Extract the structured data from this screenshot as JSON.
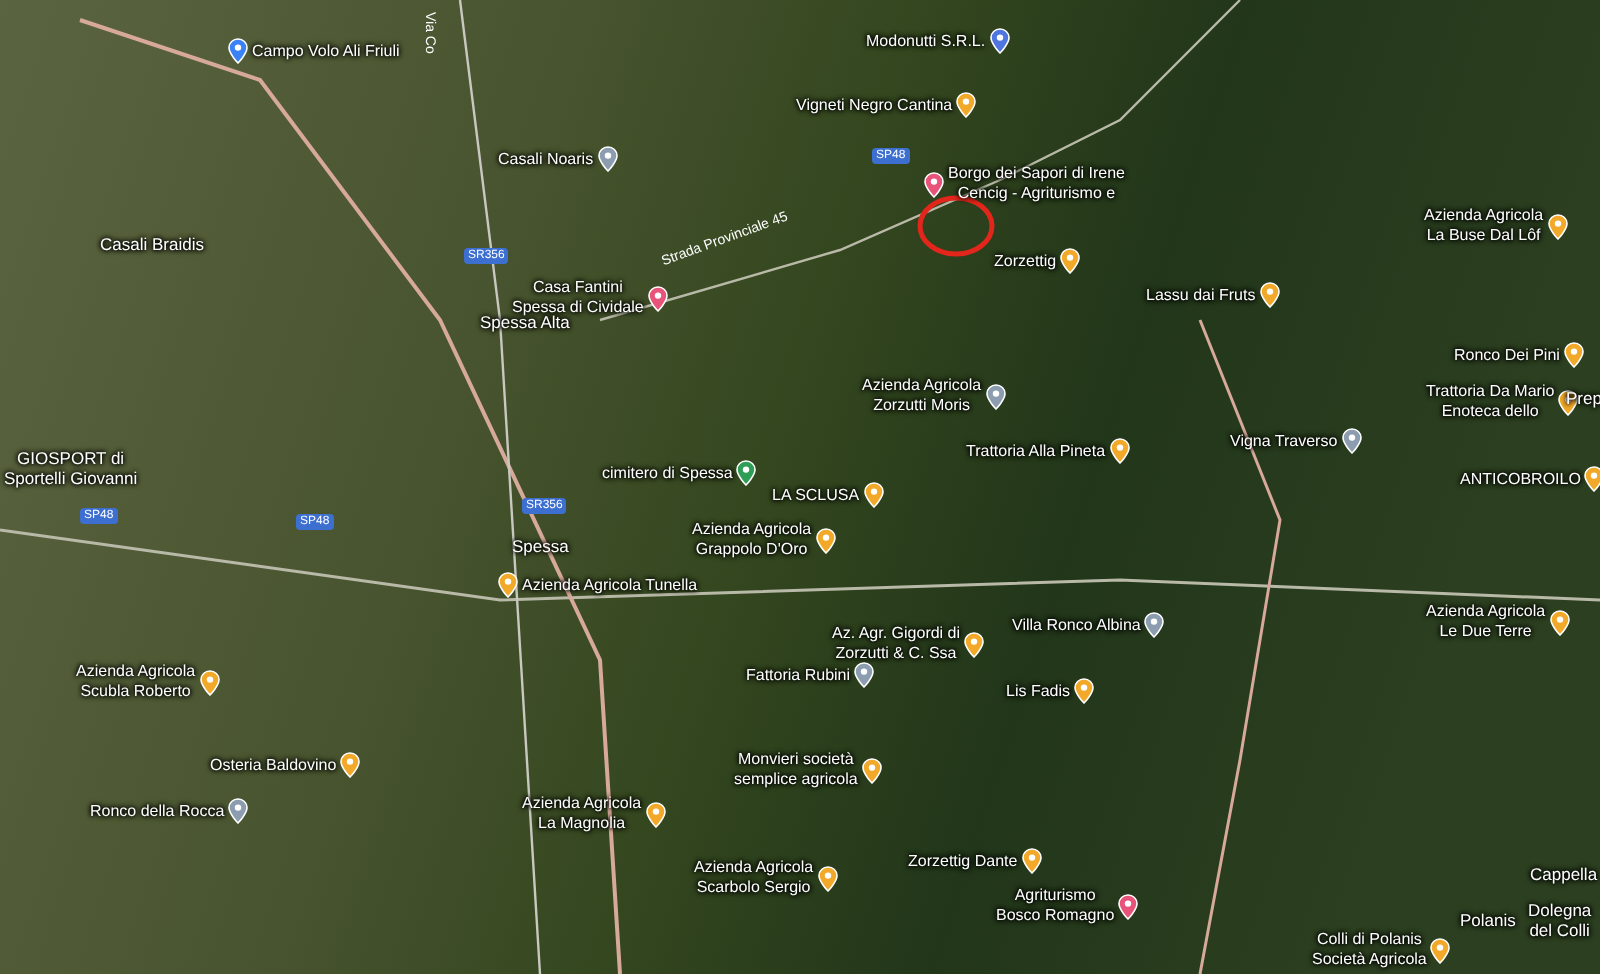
{
  "map": {
    "places": [
      {
        "kind": "airport",
        "lines": [
          "Campo Volo Ali Friuli"
        ]
      },
      {
        "kind": "shop",
        "lines": [
          "Modonutti S.R.L."
        ]
      },
      {
        "kind": "food",
        "lines": [
          "Vigneti Negro Cantina"
        ]
      },
      {
        "kind": "place",
        "lines": [
          "Casali Noaris"
        ]
      },
      {
        "kind": "hotel",
        "lines": [
          "Borgo dei Sapori di Irene",
          "Cencig - Agriturismo e"
        ]
      },
      {
        "kind": "town",
        "lines": [
          "Casali Braidis"
        ]
      },
      {
        "kind": "hotel",
        "lines": [
          "Casa Fantini",
          "Spessa di Cividale"
        ]
      },
      {
        "kind": "town",
        "lines": [
          "Spessa Alta"
        ]
      },
      {
        "kind": "food",
        "lines": [
          "Zorzettig"
        ]
      },
      {
        "kind": "food",
        "lines": [
          "Lassu dai Fruts"
        ]
      },
      {
        "kind": "food",
        "lines": [
          "Azienda Agricola",
          "La Buse Dal Lôf"
        ]
      },
      {
        "kind": "food",
        "lines": [
          "Ronco Dei Pini"
        ]
      },
      {
        "kind": "food",
        "lines": [
          "Trattoria Da Mario",
          "Enoteca dello"
        ]
      },
      {
        "kind": "town",
        "lines": [
          "Prep"
        ]
      },
      {
        "kind": "food",
        "lines": [
          "ANTICOBROILO"
        ]
      },
      {
        "kind": "food",
        "lines": [
          "Azienda Agricola",
          "Le Due Terre"
        ]
      },
      {
        "kind": "place",
        "lines": [
          "Azienda Agricola",
          "Zorzutti Moris"
        ]
      },
      {
        "kind": "food",
        "lines": [
          "Trattoria Alla Pineta"
        ]
      },
      {
        "kind": "place",
        "lines": [
          "Vigna Traverso"
        ]
      },
      {
        "kind": "town",
        "lines": [
          "GIOSPORT di",
          "Sportelli Giovanni"
        ]
      },
      {
        "kind": "park",
        "lines": [
          "cimitero di Spessa"
        ]
      },
      {
        "kind": "food",
        "lines": [
          "LA SCLUSA"
        ]
      },
      {
        "kind": "town",
        "lines": [
          "Spessa"
        ]
      },
      {
        "kind": "food",
        "lines": [
          "Azienda Agricola",
          "Grappolo D'Oro"
        ]
      },
      {
        "kind": "food",
        "lines": [
          "Azienda Agricola Tunella"
        ]
      },
      {
        "kind": "food",
        "lines": [
          "Az. Agr. Gigordi di",
          "Zorzutti & C. Ssa"
        ]
      },
      {
        "kind": "place",
        "lines": [
          "Fattoria Rubini"
        ]
      },
      {
        "kind": "place",
        "lines": [
          "Villa Ronco Albina"
        ]
      },
      {
        "kind": "food",
        "lines": [
          "Lis Fadis"
        ]
      },
      {
        "kind": "food",
        "lines": [
          "Azienda Agricola",
          "Scubla Roberto"
        ]
      },
      {
        "kind": "food",
        "lines": [
          "Osteria Baldovino"
        ]
      },
      {
        "kind": "place",
        "lines": [
          "Ronco della Rocca"
        ]
      },
      {
        "kind": "food",
        "lines": [
          "Monvieri società",
          "semplice agricola"
        ]
      },
      {
        "kind": "food",
        "lines": [
          "Azienda Agricola",
          "La Magnolia"
        ]
      },
      {
        "kind": "food",
        "lines": [
          "Azienda Agricola",
          "Scarbolo Sergio"
        ]
      },
      {
        "kind": "food",
        "lines": [
          "Zorzettig Dante"
        ]
      },
      {
        "kind": "hotel",
        "lines": [
          "Agriturismo",
          "Bosco Romagno"
        ]
      },
      {
        "kind": "food",
        "lines": [
          "Colli di Polanis",
          "Società Agricola"
        ]
      },
      {
        "kind": "town",
        "lines": [
          "Polanis"
        ]
      },
      {
        "kind": "town",
        "lines": [
          "Cappella"
        ]
      },
      {
        "kind": "town",
        "lines": [
          "Dolegna",
          "del Colli"
        ]
      }
    ],
    "road_shields": [
      "SR356",
      "SP48",
      "SP48",
      "SR356",
      "SP48"
    ],
    "road_names": [
      "Strada Provinciale 45",
      "Via Co"
    ]
  }
}
